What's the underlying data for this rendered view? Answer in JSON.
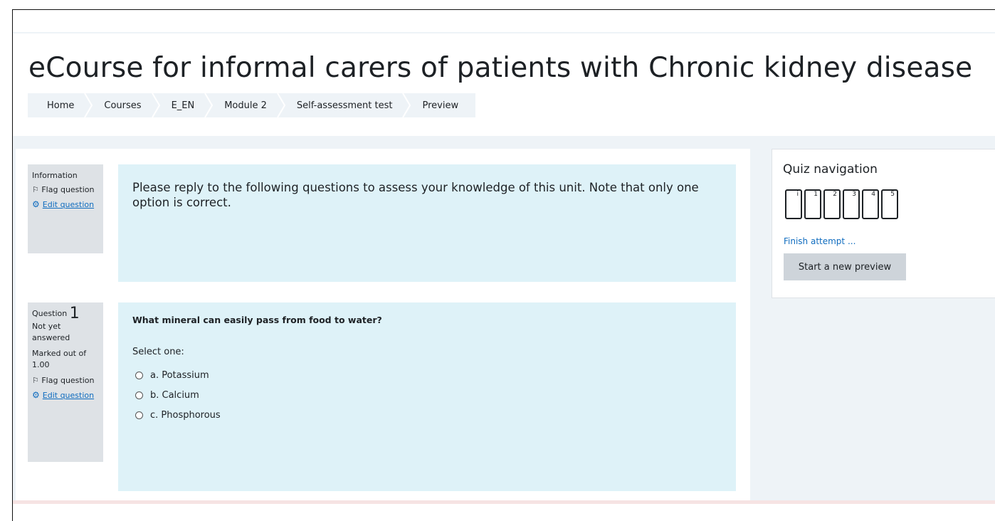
{
  "page": {
    "title": "eCourse for informal carers of patients with Chronic kidney disease"
  },
  "breadcrumb": [
    {
      "label": "Home"
    },
    {
      "label": "Courses"
    },
    {
      "label": "E_EN"
    },
    {
      "label": "Module 2"
    },
    {
      "label": "Self-assessment test"
    },
    {
      "label": "Preview"
    }
  ],
  "info_block": {
    "label": "Information",
    "flag": "Flag question",
    "edit": "Edit question",
    "text": "Please reply to the following questions to assess your knowledge of this unit. Note that only one option is correct."
  },
  "question1": {
    "prefix": "Question",
    "number": "1",
    "status": "Not yet answered",
    "marked": "Marked out of 1.00",
    "flag": "Flag question",
    "edit": "Edit question",
    "text": "What mineral can easily pass from food to water?",
    "select_label": "Select one:",
    "options": [
      {
        "label": "a. Potassium"
      },
      {
        "label": "b. Calcium"
      },
      {
        "label": "c. Phosphorous"
      }
    ]
  },
  "quiz_nav": {
    "title": "Quiz navigation",
    "buttons": [
      "i",
      "1",
      "2",
      "3",
      "4",
      "5"
    ],
    "finish_link": "Finish attempt ...",
    "new_preview_button": "Start a new preview"
  },
  "colors": {
    "accent": "#0f6cbf",
    "content_bg": "#def2f8",
    "page_bg": "#eef3f7"
  }
}
